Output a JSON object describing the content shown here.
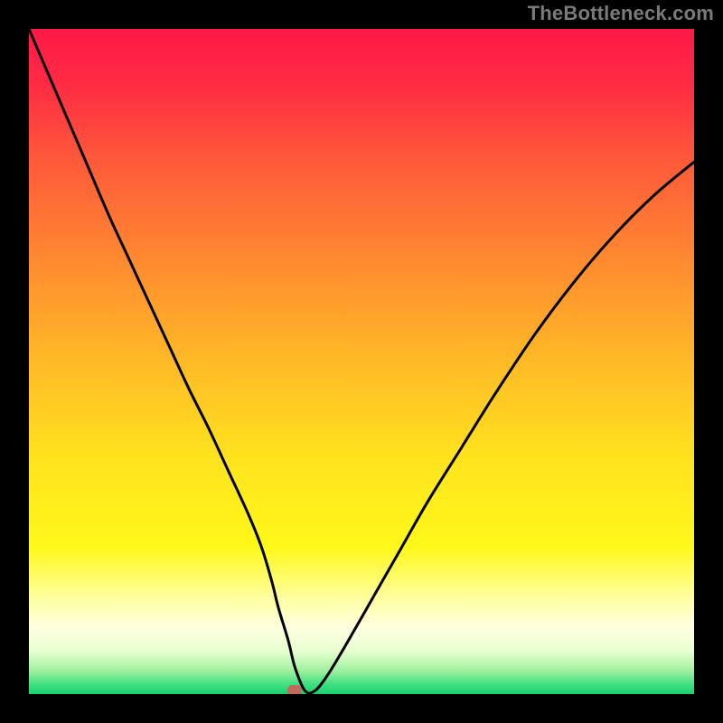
{
  "watermark": "TheBottleneck.com",
  "colors": {
    "frame": "#000000",
    "watermark": "#7a7a7a",
    "curve": "#000000",
    "marker": "#c06a5e",
    "gradient_stops": [
      {
        "offset": 0.0,
        "color": "#ff1a47"
      },
      {
        "offset": 0.08,
        "color": "#ff2a44"
      },
      {
        "offset": 0.2,
        "color": "#ff5a3a"
      },
      {
        "offset": 0.35,
        "color": "#ff8a30"
      },
      {
        "offset": 0.5,
        "color": "#ffba26"
      },
      {
        "offset": 0.65,
        "color": "#ffe41e"
      },
      {
        "offset": 0.78,
        "color": "#fff81a"
      },
      {
        "offset": 0.86,
        "color": "#ffffa8"
      },
      {
        "offset": 0.9,
        "color": "#ffffe0"
      },
      {
        "offset": 0.935,
        "color": "#e8ffd0"
      },
      {
        "offset": 0.965,
        "color": "#a0f0a0"
      },
      {
        "offset": 0.985,
        "color": "#40e080"
      },
      {
        "offset": 1.0,
        "color": "#18d070"
      }
    ]
  },
  "chart_data": {
    "type": "line",
    "title": "",
    "xlabel": "",
    "ylabel": "",
    "xlim": [
      0,
      100
    ],
    "ylim": [
      0,
      100
    ],
    "grid": false,
    "legend": false,
    "series": [
      {
        "name": "bottleneck-curve",
        "x": [
          0,
          3,
          6,
          9,
          12,
          15,
          18,
          21,
          24,
          27,
          30,
          33,
          35,
          36.5,
          37.5,
          39,
          40,
          41.5,
          43,
          45,
          48,
          52,
          56,
          60,
          65,
          70,
          76,
          82,
          88,
          94,
          100
        ],
        "y": [
          100,
          93,
          86,
          79,
          72,
          65.5,
          59,
          52.5,
          46,
          40,
          33.5,
          27,
          22,
          17,
          13,
          8,
          4,
          0.5,
          0.5,
          3,
          8,
          15,
          22,
          29,
          37,
          45,
          54,
          62,
          69,
          75,
          80
        ]
      }
    ],
    "optimum_marker": {
      "x": 40,
      "y": 0.5
    },
    "flat_bottom": {
      "x_start": 37.5,
      "x_end": 43,
      "y": 0.5
    }
  }
}
